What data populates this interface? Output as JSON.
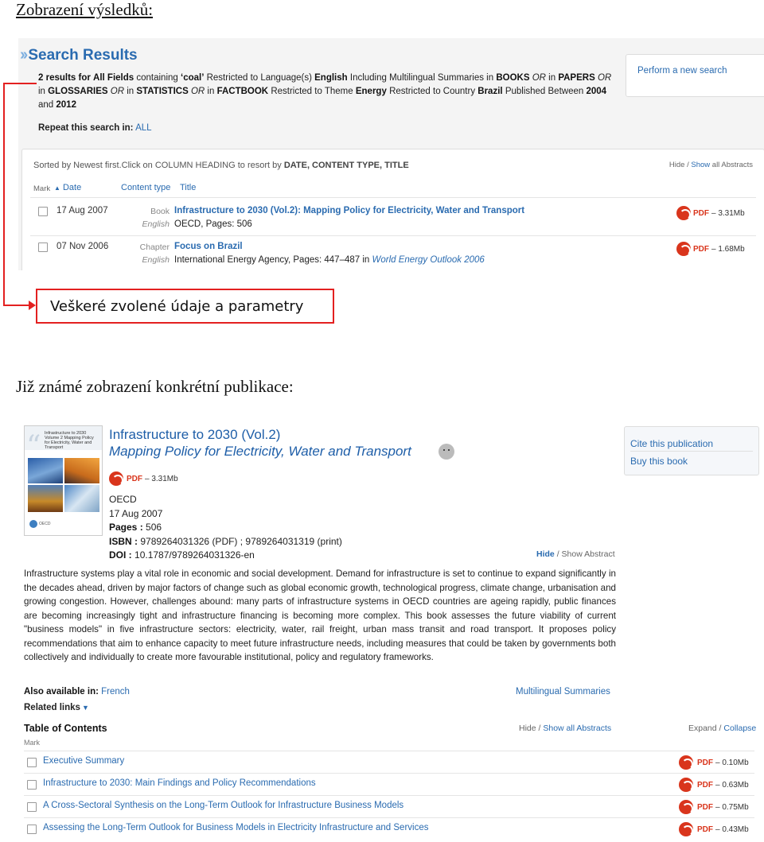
{
  "headings": {
    "results_view": "Zobrazení výsledků:",
    "publication_view": "Již známé zobrazení konkrétní publikace:"
  },
  "search_results": {
    "title": "Search Results",
    "summary_parts": {
      "count": "2 results for",
      "field": "All Fields",
      "containing": "containing",
      "term": "‘coal’",
      "restricted_lang": "Restricted to Language(s)",
      "lang": "English",
      "including": "Including Multilingual Summaries in",
      "books": "BOOKS",
      "or1": "OR",
      "in1": "in",
      "papers": "PAPERS",
      "or2": "OR",
      "in2": "in",
      "glossaries": "GLOSSARIES",
      "or3": "OR",
      "in3": "in",
      "statistics": "STATISTICS",
      "or4": "OR",
      "in4": "in",
      "factbook": "FACTBOOK",
      "restricted_theme": "Restricted to Theme",
      "theme": "Energy",
      "restricted_country": "Restricted to Country",
      "country": "Brazil",
      "published_between": "Published Between",
      "year_from": "2004",
      "and": "and",
      "year_to": "2012"
    },
    "repeat_label": "Repeat this search in:",
    "repeat_link": "ALL",
    "perform_new_search": "Perform a new search",
    "sort_prefix": "Sorted by Newest first.Click on COLUMN HEADING to resort by",
    "sort_options": "DATE, CONTENT TYPE, TITLE",
    "hide": "Hide",
    "slash": "/",
    "show_all": "Show",
    "all_abstracts": "all Abstracts",
    "columns": {
      "mark": "Mark",
      "date": "Date",
      "content_type": "Content type",
      "title": "Title"
    },
    "rows": [
      {
        "date": "17 Aug 2007",
        "type": "Book",
        "lang": "English",
        "title": "Infrastructure to 2030 (Vol.2): Mapping Policy for Electricity, Water and Transport",
        "meta": "OECD, Pages: 506",
        "meta_in": "",
        "meta_series": "",
        "pdf": "PDF",
        "dash": "–",
        "size": "3.31Mb"
      },
      {
        "date": "07 Nov 2006",
        "type": "Chapter",
        "lang": "English",
        "title": "Focus on Brazil",
        "meta": "International Energy Agency, Pages: 447–487",
        "meta_in": "in",
        "meta_series": "World Energy Outlook 2006",
        "pdf": "PDF",
        "dash": "–",
        "size": "1.68Mb"
      }
    ]
  },
  "callout": {
    "text": "Veškeré zvolené údaje a parametry",
    "color": "#e32020"
  },
  "publication": {
    "cover_text": "Infrastructure to 2030 Volume 2 Mapping Policy for Electricity, Water and Transport",
    "cover_logo": "OECD",
    "title": "Infrastructure to 2030 (Vol.2)",
    "subtitle": "Mapping Policy for Electricity, Water and Transport",
    "pdf": "PDF",
    "pdf_dash": "–",
    "pdf_size": "3.31Mb",
    "publisher": "OECD",
    "date": "17 Aug 2007",
    "pages_label": "Pages :",
    "pages": "506",
    "isbn_label": "ISBN :",
    "isbn": "9789264031326 (PDF) ; 9789264031319 (print)",
    "doi_label": "DOI :",
    "doi": "10.1787/9789264031326-en",
    "hide": "Hide",
    "slash": "/",
    "show_abstract": "Show Abstract",
    "side_links": [
      "Cite this publication",
      "Buy this book"
    ],
    "abstract": "Infrastructure systems play a vital role in economic and social development. Demand for infrastructure is set to continue to expand significantly in the decades ahead, driven by major factors of change such as global economic growth, technological progress, climate change, urbanisation and growing congestion. However, challenges abound: many parts of infrastructure systems in OECD countries are ageing rapidly, public finances are becoming increasingly tight and infrastructure financing is becoming more complex. This book assesses the future viability of current \"business models\" in five infrastructure sectors: electricity, water, rail freight, urban mass transit and road transport. It proposes policy recommendations that aim to enhance capacity to meet future infrastructure needs, including measures that could be taken by governments both collectively and individually to create more favourable institutional, policy and regulatory frameworks.",
    "also_label": "Also available in:",
    "also_lang": "French",
    "multilingual": "Multilingual Summaries",
    "related": "Related links",
    "toc_title": "Table of Contents",
    "toc_hide": "Hide",
    "toc_slash": "/",
    "toc_show_all": "Show all Abstracts",
    "expand": "Expand",
    "toc_slash2": "/",
    "collapse": "Collapse",
    "mark": "Mark",
    "toc": [
      {
        "title": "Executive Summary",
        "pdf": "PDF",
        "dash": "–",
        "size": "0.10Mb"
      },
      {
        "title": "Infrastructure to 2030: Main Findings and Policy Recommendations",
        "pdf": "PDF",
        "dash": "–",
        "size": "0.63Mb"
      },
      {
        "title": "A Cross-Sectoral Synthesis on the Long-Term Outlook for Infrastructure Business Models",
        "pdf": "PDF",
        "dash": "–",
        "size": "0.75Mb"
      },
      {
        "title": "Assessing the Long-Term Outlook for Business Models in Electricity Infrastructure and Services",
        "pdf": "PDF",
        "dash": "–",
        "size": "0.43Mb"
      }
    ]
  }
}
